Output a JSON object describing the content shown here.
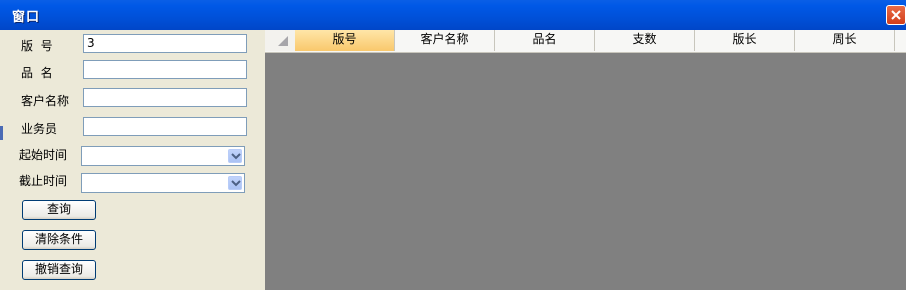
{
  "window": {
    "title": "窗口"
  },
  "form": {
    "ban_hao_label": "版  号",
    "ban_hao_value": "3",
    "pin_ming_label": "品  名",
    "pin_ming_value": "",
    "ke_hu_label": "客户名称",
    "ke_hu_value": "",
    "ye_wu_label": "业务员",
    "ye_wu_value": "",
    "start_time_label": "起始时间",
    "start_time_value": "",
    "end_time_label": "截止时间",
    "end_time_value": ""
  },
  "buttons": {
    "query": "查询",
    "clear": "清除条件",
    "cancel": "撤销查询"
  },
  "grid": {
    "columns": [
      "版号",
      "客户名称",
      "品名",
      "支数",
      "版长",
      "周长"
    ],
    "selected_column": "版号",
    "rows": []
  },
  "icons": {
    "close": "close-icon",
    "dropdown": "chevron-down-icon",
    "corner": "select-all-icon"
  },
  "colors": {
    "titlebar": "#0050D8",
    "selected_header": "#F9C86C",
    "grid_background": "#808080",
    "panel": "#ECE9D8"
  }
}
